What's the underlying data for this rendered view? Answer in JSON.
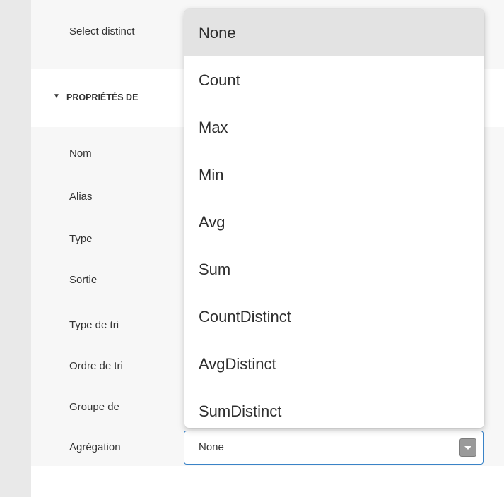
{
  "top_row": {
    "label": "Select distinct"
  },
  "section": {
    "arrow": "▼",
    "title": "PROPRIÉTÉS DE"
  },
  "properties": [
    {
      "label": "Nom"
    },
    {
      "label": "Alias"
    },
    {
      "label": "Type"
    },
    {
      "label": "Sortie"
    },
    {
      "label": "Type de tri"
    },
    {
      "label": "Ordre de tri"
    },
    {
      "label": "Groupe de"
    },
    {
      "label": "Agrégation"
    }
  ],
  "aggregation_select": {
    "value": "None",
    "icon": "chevron-down-icon"
  },
  "dropdown": {
    "selected": "None",
    "options": [
      "None",
      "Count",
      "Max",
      "Min",
      "Avg",
      "Sum",
      "CountDistinct",
      "AvgDistinct",
      "SumDistinct"
    ]
  },
  "colors": {
    "focus_border": "#3a83c7",
    "selected_option_bg": "#e3e3e3",
    "row_bg": "#f7f7f7",
    "left_strip": "#e9e9e9"
  }
}
